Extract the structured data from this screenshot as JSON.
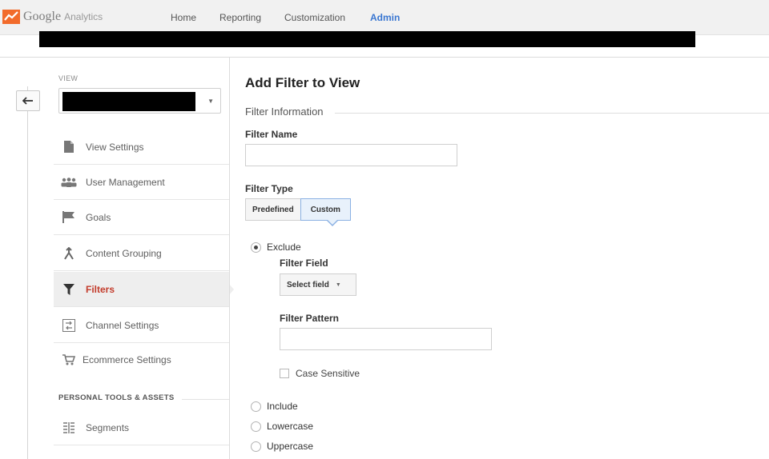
{
  "header": {
    "brand_google": "Google",
    "brand_product": "Analytics",
    "nav": [
      {
        "label": "Home"
      },
      {
        "label": "Reporting"
      },
      {
        "label": "Customization"
      },
      {
        "label": "Admin"
      }
    ],
    "active_nav": "Admin",
    "accent_color": "#3a77d1"
  },
  "sidebar": {
    "view_label": "VIEW",
    "items": [
      {
        "label": "View Settings",
        "icon": "document-icon"
      },
      {
        "label": "User Management",
        "icon": "users-icon"
      },
      {
        "label": "Goals",
        "icon": "flag-icon"
      },
      {
        "label": "Content Grouping",
        "icon": "grouping-icon"
      },
      {
        "label": "Filters",
        "icon": "filter-icon"
      },
      {
        "label": "Channel Settings",
        "icon": "channel-icon"
      },
      {
        "label": "Ecommerce Settings",
        "icon": "cart-icon"
      }
    ],
    "active_item": "Filters",
    "active_color": "#c33c2c",
    "section_header": "PERSONAL TOOLS & ASSETS",
    "section_items": [
      {
        "label": "Segments",
        "icon": "segments-icon"
      }
    ]
  },
  "main": {
    "title": "Add Filter to View",
    "fieldset_legend": "Filter Information",
    "filter_name_label": "Filter Name",
    "filter_name_value": "",
    "filter_type_label": "Filter Type",
    "filter_type_options": [
      "Predefined",
      "Custom"
    ],
    "filter_type_selected": "Custom",
    "radios": {
      "exclude": "Exclude",
      "include": "Include",
      "lowercase": "Lowercase",
      "uppercase": "Uppercase"
    },
    "radio_selected": "Exclude",
    "filter_field_label": "Filter Field",
    "filter_field_value": "Select field",
    "filter_pattern_label": "Filter Pattern",
    "filter_pattern_value": "",
    "case_sensitive_label": "Case Sensitive",
    "case_sensitive_checked": false
  }
}
